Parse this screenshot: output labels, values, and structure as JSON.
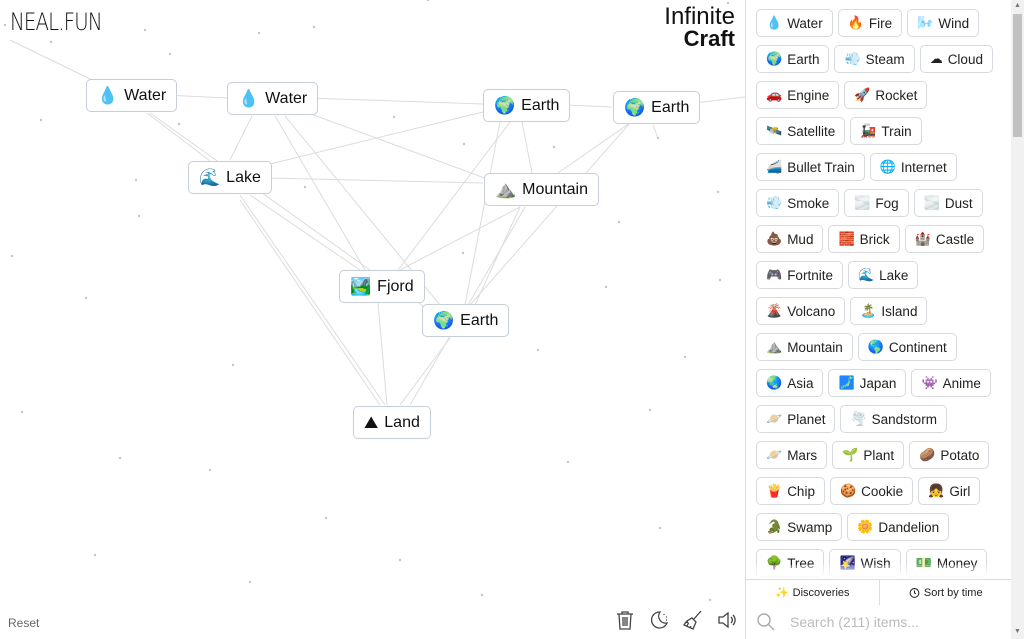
{
  "header": {
    "logo": "NEAL.FUN",
    "title_line1": "Infinite",
    "title_line2": "Craft"
  },
  "canvas": {
    "nodes": [
      {
        "id": "water1",
        "label": "Water",
        "icon": "droplet-icon",
        "emoji": "💧"
      },
      {
        "id": "water2",
        "label": "Water",
        "icon": "droplet-icon",
        "emoji": "💧"
      },
      {
        "id": "earth1",
        "label": "Earth",
        "icon": "globe-icon",
        "emoji": "🌍"
      },
      {
        "id": "earth2",
        "label": "Earth",
        "icon": "globe-icon",
        "emoji": "🌍"
      },
      {
        "id": "lake",
        "label": "Lake",
        "icon": "wave-icon",
        "emoji": "🌊"
      },
      {
        "id": "mountain",
        "label": "Mountain",
        "icon": "mountain-icon",
        "emoji": "⛰️"
      },
      {
        "id": "fjord",
        "label": "Fjord",
        "icon": "fjord-icon",
        "emoji": "🏞️"
      },
      {
        "id": "earth3",
        "label": "Earth",
        "icon": "globe-icon",
        "emoji": "🌍"
      },
      {
        "id": "land",
        "label": "Land",
        "icon": "land-icon",
        "emoji": "⛰"
      }
    ],
    "reset_label": "Reset",
    "tools": [
      {
        "name": "trash-icon",
        "label": "Clear"
      },
      {
        "name": "moon-icon",
        "label": "Dark mode"
      },
      {
        "name": "broom-icon",
        "label": "Clean up"
      },
      {
        "name": "speaker-icon",
        "label": "Sound"
      }
    ]
  },
  "sidebar": {
    "items": [
      {
        "label": "Water",
        "emoji": "💧"
      },
      {
        "label": "Fire",
        "emoji": "🔥"
      },
      {
        "label": "Wind",
        "emoji": "🌬️"
      },
      {
        "label": "Earth",
        "emoji": "🌍"
      },
      {
        "label": "Steam",
        "emoji": "💨"
      },
      {
        "label": "Cloud",
        "emoji": "☁"
      },
      {
        "label": "Engine",
        "emoji": "🚗"
      },
      {
        "label": "Rocket",
        "emoji": "🚀"
      },
      {
        "label": "Satellite",
        "emoji": "🛰️"
      },
      {
        "label": "Train",
        "emoji": "🚂"
      },
      {
        "label": "Bullet Train",
        "emoji": "🚄"
      },
      {
        "label": "Internet",
        "emoji": "🌐"
      },
      {
        "label": "Smoke",
        "emoji": "💨"
      },
      {
        "label": "Fog",
        "emoji": "🌫️"
      },
      {
        "label": "Dust",
        "emoji": "🌫️"
      },
      {
        "label": "Mud",
        "emoji": "💩"
      },
      {
        "label": "Brick",
        "emoji": "🧱"
      },
      {
        "label": "Castle",
        "emoji": "🏰"
      },
      {
        "label": "Fortnite",
        "emoji": "🎮"
      },
      {
        "label": "Lake",
        "emoji": "🌊"
      },
      {
        "label": "Volcano",
        "emoji": "🌋"
      },
      {
        "label": "Island",
        "emoji": "🏝️"
      },
      {
        "label": "Mountain",
        "emoji": "⛰️"
      },
      {
        "label": "Continent",
        "emoji": "🌎"
      },
      {
        "label": "Asia",
        "emoji": "🌏"
      },
      {
        "label": "Japan",
        "emoji": "🗾"
      },
      {
        "label": "Anime",
        "emoji": "👾"
      },
      {
        "label": "Planet",
        "emoji": "🪐"
      },
      {
        "label": "Sandstorm",
        "emoji": "🌪️"
      },
      {
        "label": "Mars",
        "emoji": "🪐"
      },
      {
        "label": "Plant",
        "emoji": "🌱"
      },
      {
        "label": "Potato",
        "emoji": "🥔"
      },
      {
        "label": "Chip",
        "emoji": "🍟"
      },
      {
        "label": "Cookie",
        "emoji": "🍪"
      },
      {
        "label": "Girl",
        "emoji": "👧"
      },
      {
        "label": "Swamp",
        "emoji": "🐊"
      },
      {
        "label": "Dandelion",
        "emoji": "🌼"
      },
      {
        "label": "Tree",
        "emoji": "🌳"
      },
      {
        "label": "Wish",
        "emoji": "🌠"
      },
      {
        "label": "Money",
        "emoji": "💵"
      }
    ],
    "discoveries_label": "Discoveries",
    "sort_label": "Sort by time",
    "search_placeholder": "Search (211) items..."
  }
}
